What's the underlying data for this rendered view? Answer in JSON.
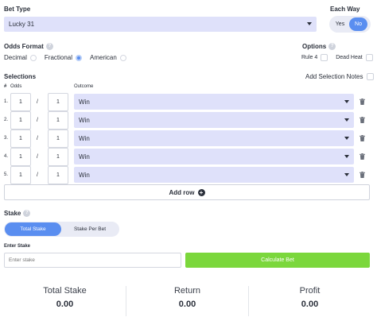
{
  "bet_type": {
    "label": "Bet Type",
    "selected": "Lucky 31"
  },
  "each_way": {
    "label": "Each Way",
    "yes": "Yes",
    "no": "No",
    "selected": "No"
  },
  "odds_format": {
    "label": "Odds Format",
    "options": [
      "Decimal",
      "Fractional",
      "American"
    ],
    "selected": "Fractional"
  },
  "options": {
    "label": "Options",
    "rule4": "Rule 4",
    "dead_heat": "Dead Heat"
  },
  "selections": {
    "label": "Selections",
    "add_notes": "Add Selection Notes",
    "col_num": "#",
    "col_odds": "Odds",
    "col_outcome": "Outcome",
    "rows": [
      {
        "num": "1.",
        "num_odds": "1",
        "sep": "/",
        "den_odds": "1",
        "outcome": "Win"
      },
      {
        "num": "2.",
        "num_odds": "1",
        "sep": "/",
        "den_odds": "1",
        "outcome": "Win"
      },
      {
        "num": "3.",
        "num_odds": "1",
        "sep": "/",
        "den_odds": "1",
        "outcome": "Win"
      },
      {
        "num": "4.",
        "num_odds": "1",
        "sep": "/",
        "den_odds": "1",
        "outcome": "Win"
      },
      {
        "num": "5.",
        "num_odds": "1",
        "sep": "/",
        "den_odds": "1",
        "outcome": "Win"
      }
    ],
    "add_row": "Add row"
  },
  "stake": {
    "label": "Stake",
    "tabs": [
      "Total Stake",
      "Stake Per Bet"
    ],
    "active_tab": "Total Stake",
    "enter_label": "Enter Stake",
    "placeholder": "Enter stake",
    "calc_label": "Calculate Bet"
  },
  "summary": {
    "total_stake_label": "Total Stake",
    "total_stake": "0.00",
    "return_label": "Return",
    "return": "0.00",
    "profit_label": "Profit",
    "profit": "0.00"
  },
  "colors": {
    "accent": "#5a8ef0",
    "calc": "#7bd73c",
    "select_bg": "#dfe1fa"
  },
  "icons": {
    "info": "info-icon",
    "caret": "chevron-down-icon",
    "trash": "trash-icon",
    "add": "plus-circle-icon"
  }
}
